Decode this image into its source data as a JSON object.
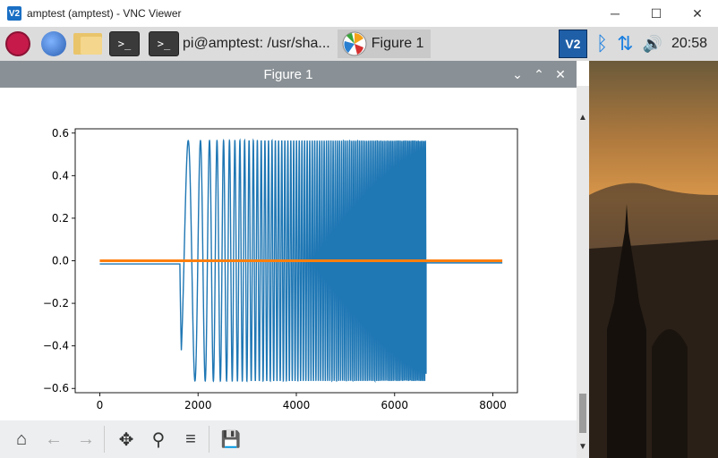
{
  "vnc": {
    "title": "amptest (amptest) - VNC Viewer",
    "logo": "V2",
    "minimize": "─",
    "maximize": "☐",
    "close": "✕"
  },
  "taskbar": {
    "terminal_prompt": ">_",
    "tasks": [
      {
        "label": "pi@amptest: /usr/sha...",
        "icon": "terminal-icon"
      },
      {
        "label": "Figure 1",
        "icon": "matplotlib-icon"
      }
    ],
    "tray": {
      "vnc": "V2",
      "bluetooth": "ᛒ",
      "network": "⇅",
      "volume": "🔊",
      "clock": "20:58"
    }
  },
  "figure": {
    "title": "Figure 1",
    "ctrl_down": "⌄",
    "ctrl_up": "⌃",
    "ctrl_close": "✕"
  },
  "toolbar": {
    "home": "⌂",
    "back": "←",
    "forward": "→",
    "pan": "✥",
    "zoom": "⚲",
    "configure": "≡",
    "save": "💾"
  },
  "scrollbar": {
    "up": "▲",
    "down": "▼"
  },
  "chart_data": {
    "type": "line",
    "title": "",
    "xlabel": "",
    "ylabel": "",
    "xlim": [
      -500,
      8500
    ],
    "ylim": [
      -0.62,
      0.62
    ],
    "xticks": [
      0,
      2000,
      4000,
      6000,
      8000
    ],
    "yticks": [
      -0.6,
      -0.4,
      -0.2,
      0.0,
      0.2,
      0.4,
      0.6
    ],
    "xtick_labels": [
      "0",
      "2000",
      "4000",
      "6000",
      "8000"
    ],
    "ytick_labels": [
      "−0.6",
      "−0.4",
      "−0.2",
      "0.0",
      "0.2",
      "0.4",
      "0.6"
    ],
    "grid": false,
    "series": [
      {
        "color": "#1f77b4",
        "description": "chirp",
        "flat_before": {
          "x": [
            0,
            1630
          ],
          "y": -0.015
        },
        "chirp": {
          "x": [
            1630,
            6640
          ],
          "amplitude": 0.565,
          "first_trough_x": 1800,
          "first_peak_x": 2040,
          "min": -0.57,
          "max": 0.56
        },
        "flat_after": {
          "x": [
            6640,
            8192
          ],
          "y": -0.01
        }
      },
      {
        "color": "#ff7f0e",
        "description": "flat",
        "x": [
          0,
          8192
        ],
        "y": [
          0.0,
          0.0
        ]
      }
    ]
  }
}
